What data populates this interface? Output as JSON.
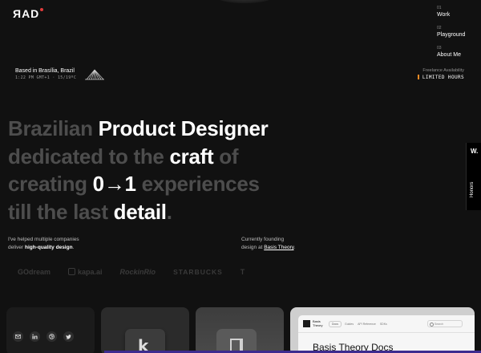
{
  "header": {
    "logo": "ЯAD",
    "nav": [
      {
        "num": "01",
        "label": "Work"
      },
      {
        "num": "02",
        "label": "Playground"
      },
      {
        "num": "03",
        "label": "About Me"
      }
    ]
  },
  "location": {
    "title": "Based in Brasília, Brazil",
    "time": "1:22 PM GMT+1 · 15/19ºC"
  },
  "freelance": {
    "title": "Freelance Availability",
    "status": "LIMITED HOURS",
    "status_color": "#f08a24"
  },
  "headline": {
    "l1a": "Brazilian ",
    "l1b": "Product Designer",
    "l2a": "dedicated to the ",
    "l2b": "craft",
    "l2c": " of",
    "l3a": "creating ",
    "l3b": "0→1",
    "l3c": " experiences",
    "l4a": "till the last ",
    "l4b": "detail",
    "l4c": "."
  },
  "intro": {
    "left_line1": "I've helped multiple companies",
    "left_line2_a": "deliver ",
    "left_line2_b": "high-quality design",
    "left_line2_c": ".",
    "right_line1": "Currently founding",
    "right_line2_a": "design at ",
    "right_line2_link": "Basis Theory",
    "right_line2_c": "."
  },
  "clients": [
    "GOdream",
    "kapa.ai",
    "RockinRio",
    "STARBUCKS",
    "T"
  ],
  "honors": {
    "mark": "W.",
    "label": "Honors"
  },
  "socials": [
    "mail-icon",
    "linkedin-icon",
    "dribbble-icon",
    "twitter-icon"
  ],
  "projects": {
    "kapa_letter": "k",
    "basis": {
      "brand": "Basis Theory",
      "pill": "Docs",
      "links": [
        "Guides",
        "API Reference",
        "SDKs"
      ],
      "search": "Search",
      "title": "Basis Theory Docs"
    }
  },
  "colors": {
    "background": "#111111",
    "accent_red": "#e23b3b",
    "bottom_bar": "#3d2b8f"
  }
}
